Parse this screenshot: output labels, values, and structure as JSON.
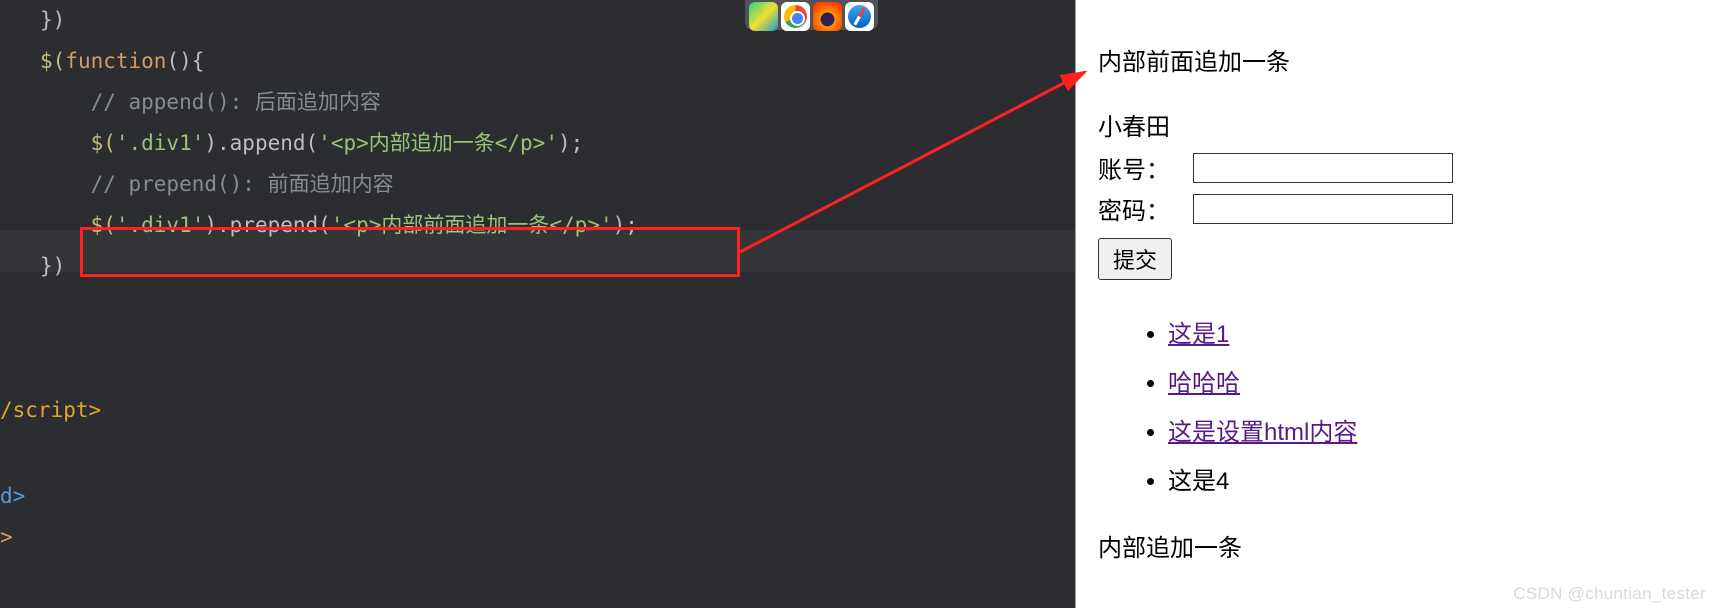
{
  "editor": {
    "lines": {
      "l1": "})",
      "l2": "",
      "l3_a": "$(",
      "l3_b": "function",
      "l3_c": "(){",
      "l4": "    // append(): 后面追加内容",
      "l5_a": "    $(",
      "l5_b": "'.div1'",
      "l5_c": ").append(",
      "l5_d": "'<p>内部追加一条</p>'",
      "l5_e": ");",
      "l6": "    // prepend(): 前面追加内容",
      "l7_a": "    $(",
      "l7_b": "'.div1'",
      "l7_c": ").prepend(",
      "l7_d": "'<p>内部前面追加一条</p>'",
      "l7_e": ");",
      "l8": "})",
      "l_script": "/script>",
      "l_d": "d>",
      "l_arrow": ">"
    }
  },
  "page": {
    "prepend_text": "内部前面追加一条",
    "subtitle": "小春田",
    "account_label": "账号：",
    "password_label": "密码：",
    "submit_label": "提交",
    "list": {
      "item1": "这是1",
      "item2": "哈哈哈",
      "item3": "这是设置html内容",
      "item4": "这是4"
    },
    "append_text": "内部追加一条"
  },
  "watermark": "CSDN @chuntian_tester",
  "dock": {
    "pycharm": "pycharm-icon",
    "chrome": "chrome-icon",
    "firefox": "firefox-icon",
    "safari": "safari-icon"
  }
}
